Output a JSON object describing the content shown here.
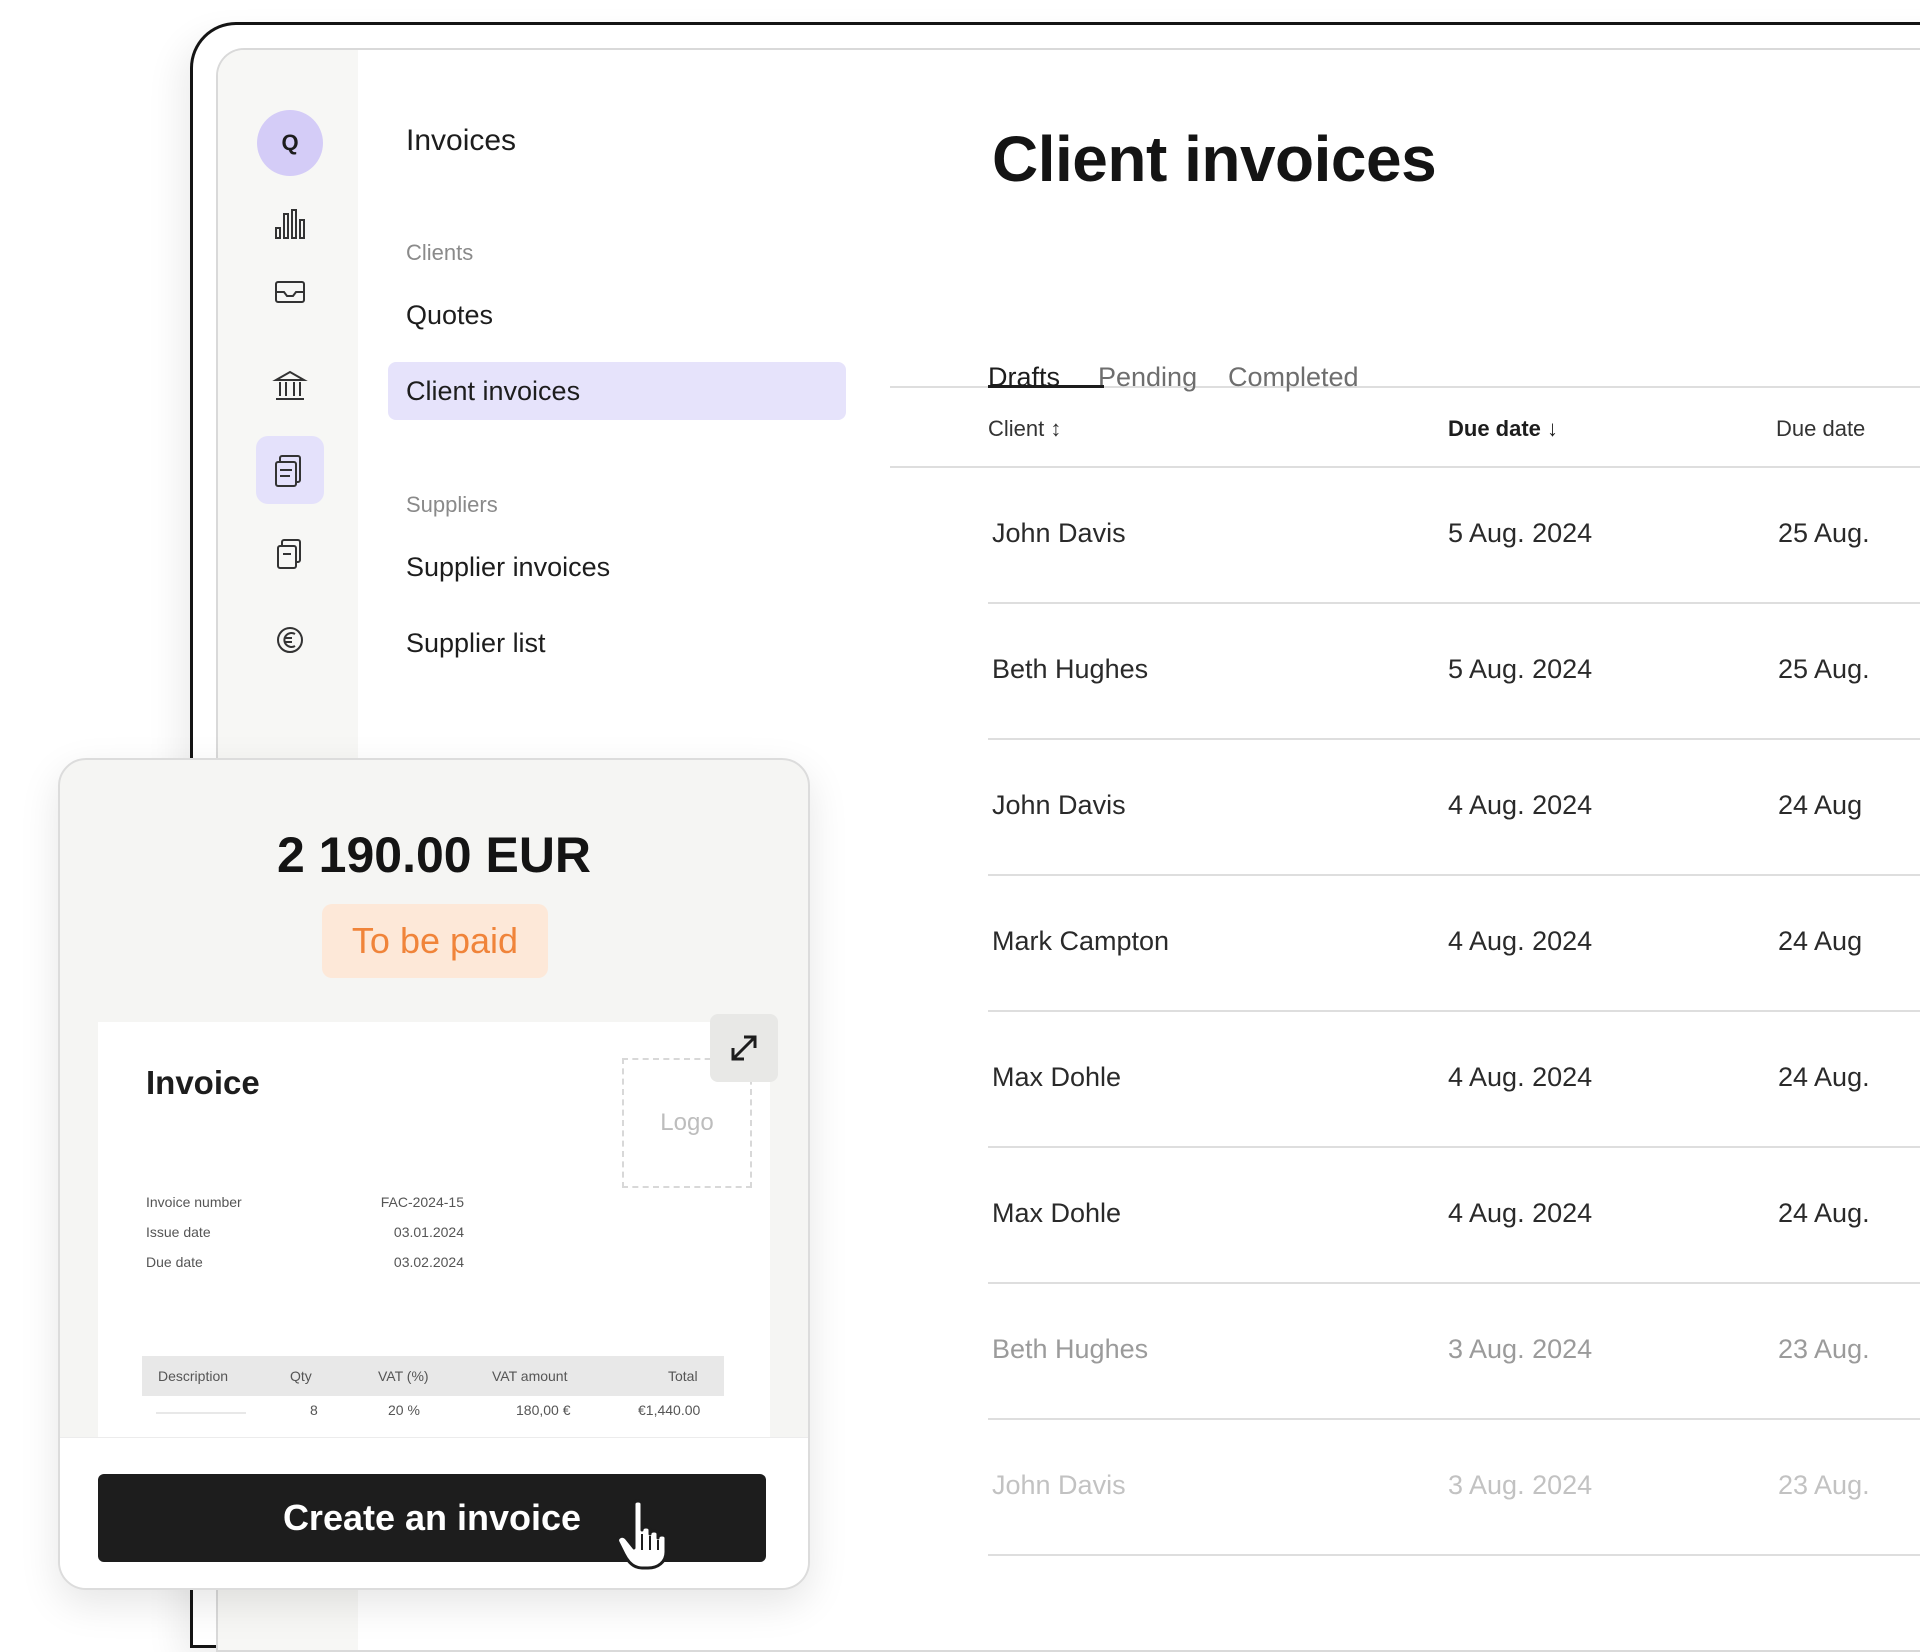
{
  "rail": {
    "avatar_initial": "Q"
  },
  "subnav": {
    "title": "Invoices",
    "section_clients": "Clients",
    "item_quotes": "Quotes",
    "item_client_invoices": "Client invoices",
    "section_suppliers": "Suppliers",
    "item_supplier_invoices": "Supplier invoices",
    "item_supplier_list": "Supplier list"
  },
  "main": {
    "title": "Client invoices",
    "tabs": [
      {
        "label": "Drafts"
      },
      {
        "label": "Pending"
      },
      {
        "label": "Completed"
      }
    ],
    "columns": {
      "client": "Client ↕",
      "due_date_sorted": "Due date ↓",
      "due_date_2": "Due date"
    },
    "rows": [
      {
        "client": "John Davis",
        "due": "5 Aug. 2024",
        "due2": "25 Aug."
      },
      {
        "client": "Beth Hughes",
        "due": "5 Aug. 2024",
        "due2": "25 Aug."
      },
      {
        "client": "John Davis",
        "due": "4 Aug. 2024",
        "due2": "24 Aug"
      },
      {
        "client": "Mark Campton",
        "due": "4 Aug. 2024",
        "due2": "24 Aug"
      },
      {
        "client": "Max Dohle",
        "due": "4 Aug. 2024",
        "due2": "24 Aug."
      },
      {
        "client": "Max Dohle",
        "due": "4 Aug. 2024",
        "due2": "24 Aug."
      },
      {
        "client": "Beth Hughes",
        "due": "3 Aug. 2024",
        "due2": "23 Aug."
      },
      {
        "client": "John Davis",
        "due": "3 Aug. 2024",
        "due2": "23 Aug."
      }
    ]
  },
  "card": {
    "amount": "2 190.00 EUR",
    "status": "To be paid",
    "status_color": "#f0843a",
    "invoice": {
      "title": "Invoice",
      "logo_placeholder": "Logo",
      "meta": [
        {
          "label": "Invoice number",
          "value": "FAC-2024-15"
        },
        {
          "label": "Issue date",
          "value": "03.01.2024"
        },
        {
          "label": "Due date",
          "value": "03.02.2024"
        }
      ],
      "table_headers": [
        "Description",
        "Qty",
        "VAT (%)",
        "VAT amount",
        "Total"
      ],
      "table_row": [
        "",
        "8",
        "20 %",
        "180,00 €",
        "€1,440.00"
      ]
    },
    "cta_label": "Create an invoice"
  },
  "colors": {
    "accent_light": "#e4e1fb",
    "avatar_bg": "#d4ccf7",
    "cta_bg": "#1d1d1d",
    "badge_bg": "#fde8d8"
  },
  "icons": [
    "bar-chart-icon",
    "inbox-icon",
    "bank-icon",
    "invoice-icon",
    "documents-icon",
    "euro-icon",
    "expand-icon",
    "hand-pointer-icon"
  ]
}
